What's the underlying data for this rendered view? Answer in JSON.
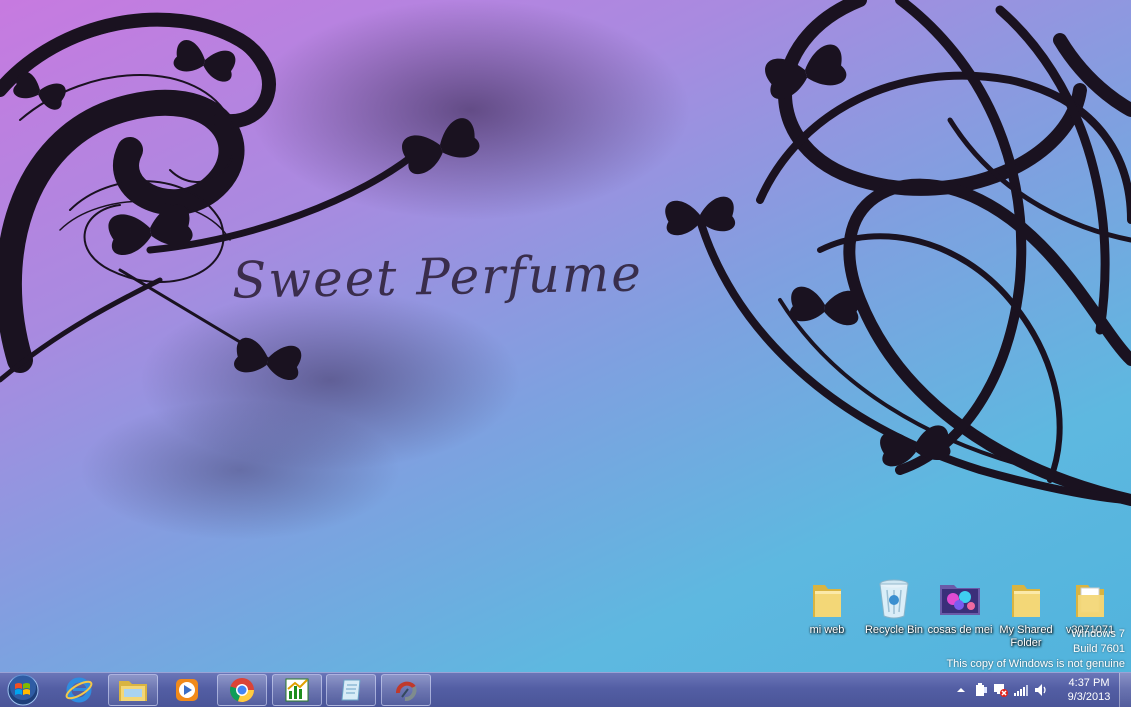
{
  "wallpaper": {
    "text": "Sweet Perfume"
  },
  "desktop_icons": [
    {
      "label": "mi web",
      "icon": "folder-icon"
    },
    {
      "label": "Recycle Bin",
      "icon": "recycle-bin-icon"
    },
    {
      "label": "cosas de mei",
      "icon": "image-folder-icon"
    },
    {
      "label": "My Shared Folder",
      "icon": "folder-icon"
    },
    {
      "label": "v3071071",
      "icon": "folder-icon"
    }
  ],
  "watermark": {
    "line1": "Windows 7",
    "line2": "Build 7601",
    "line3": "This copy of Windows is not genuine"
  },
  "taskbar": {
    "start": "start-orb-icon",
    "pinned": [
      {
        "name": "internet-explorer",
        "icon": "internet-explorer-icon",
        "open": false
      },
      {
        "name": "windows-explorer",
        "icon": "folder-icon",
        "open": true
      },
      {
        "name": "media-player",
        "icon": "media-player-icon",
        "open": false
      },
      {
        "name": "google-chrome",
        "icon": "chrome-icon",
        "open": true
      },
      {
        "name": "chart-app",
        "icon": "chart-app-icon",
        "open": true
      },
      {
        "name": "notepad-app",
        "icon": "notepad-icon",
        "open": true
      },
      {
        "name": "spinner-app",
        "icon": "spinner-icon",
        "open": true
      }
    ],
    "tray": {
      "time": "4:37 PM",
      "date": "9/3/2013",
      "icons": [
        "show-hidden-icons-icon",
        "power-icon",
        "network-error-icon",
        "signal-icon",
        "volume-icon"
      ]
    }
  },
  "colors": {
    "wallpaper_top": "#c77ae0",
    "wallpaper_bottom": "#4fb3dc",
    "taskbar": "#535ea4",
    "ink": "#1a1220"
  }
}
